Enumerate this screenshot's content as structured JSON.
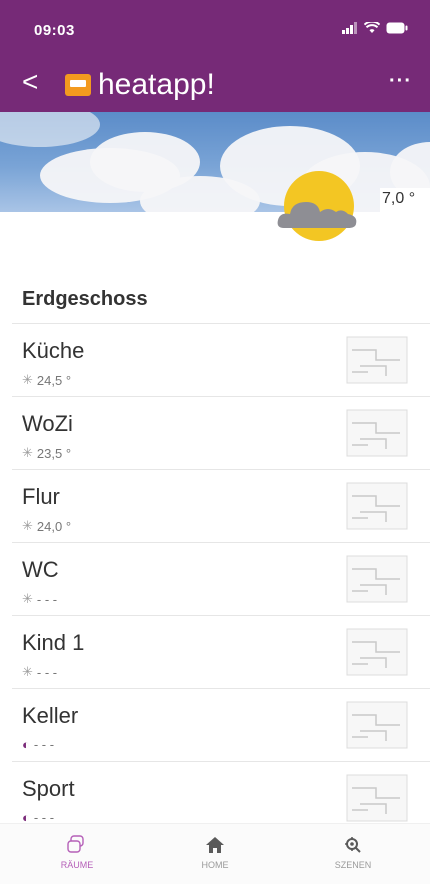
{
  "status": {
    "time": "09:03"
  },
  "app": {
    "back": "<",
    "title": "heatapp!",
    "more": "···"
  },
  "weather": {
    "outdoor_temp": "7,0 °"
  },
  "section": {
    "title": "Erdgeschoss"
  },
  "rooms": [
    {
      "name": "Küche",
      "symbol": "✳",
      "symbol_type": "sun",
      "temp": "24,5 °"
    },
    {
      "name": "WoZi",
      "symbol": "✳",
      "symbol_type": "sun",
      "temp": "23,5 °"
    },
    {
      "name": "Flur",
      "symbol": "✳",
      "symbol_type": "sun",
      "temp": "24,0 °"
    },
    {
      "name": "WC",
      "symbol": "✳",
      "symbol_type": "sun",
      "temp": "- - -"
    },
    {
      "name": "Kind 1",
      "symbol": "✳",
      "symbol_type": "sun",
      "temp": "- - -"
    },
    {
      "name": "Keller",
      "symbol": "◐",
      "symbol_type": "moon",
      "temp": "- - -"
    },
    {
      "name": "Sport",
      "symbol": "◐",
      "symbol_type": "moon",
      "temp": "- - -"
    }
  ],
  "tabs": [
    {
      "label": "RÄUME",
      "icon": "rooms-icon"
    },
    {
      "label": "HOME",
      "icon": "home-icon"
    },
    {
      "label": "SZENEN",
      "icon": "scenes-icon"
    }
  ],
  "colors": {
    "brand": "#762a77",
    "sun": "#f3c623",
    "tab_active": "#b55fb8",
    "tab_inactive": "#9a9a9a"
  }
}
